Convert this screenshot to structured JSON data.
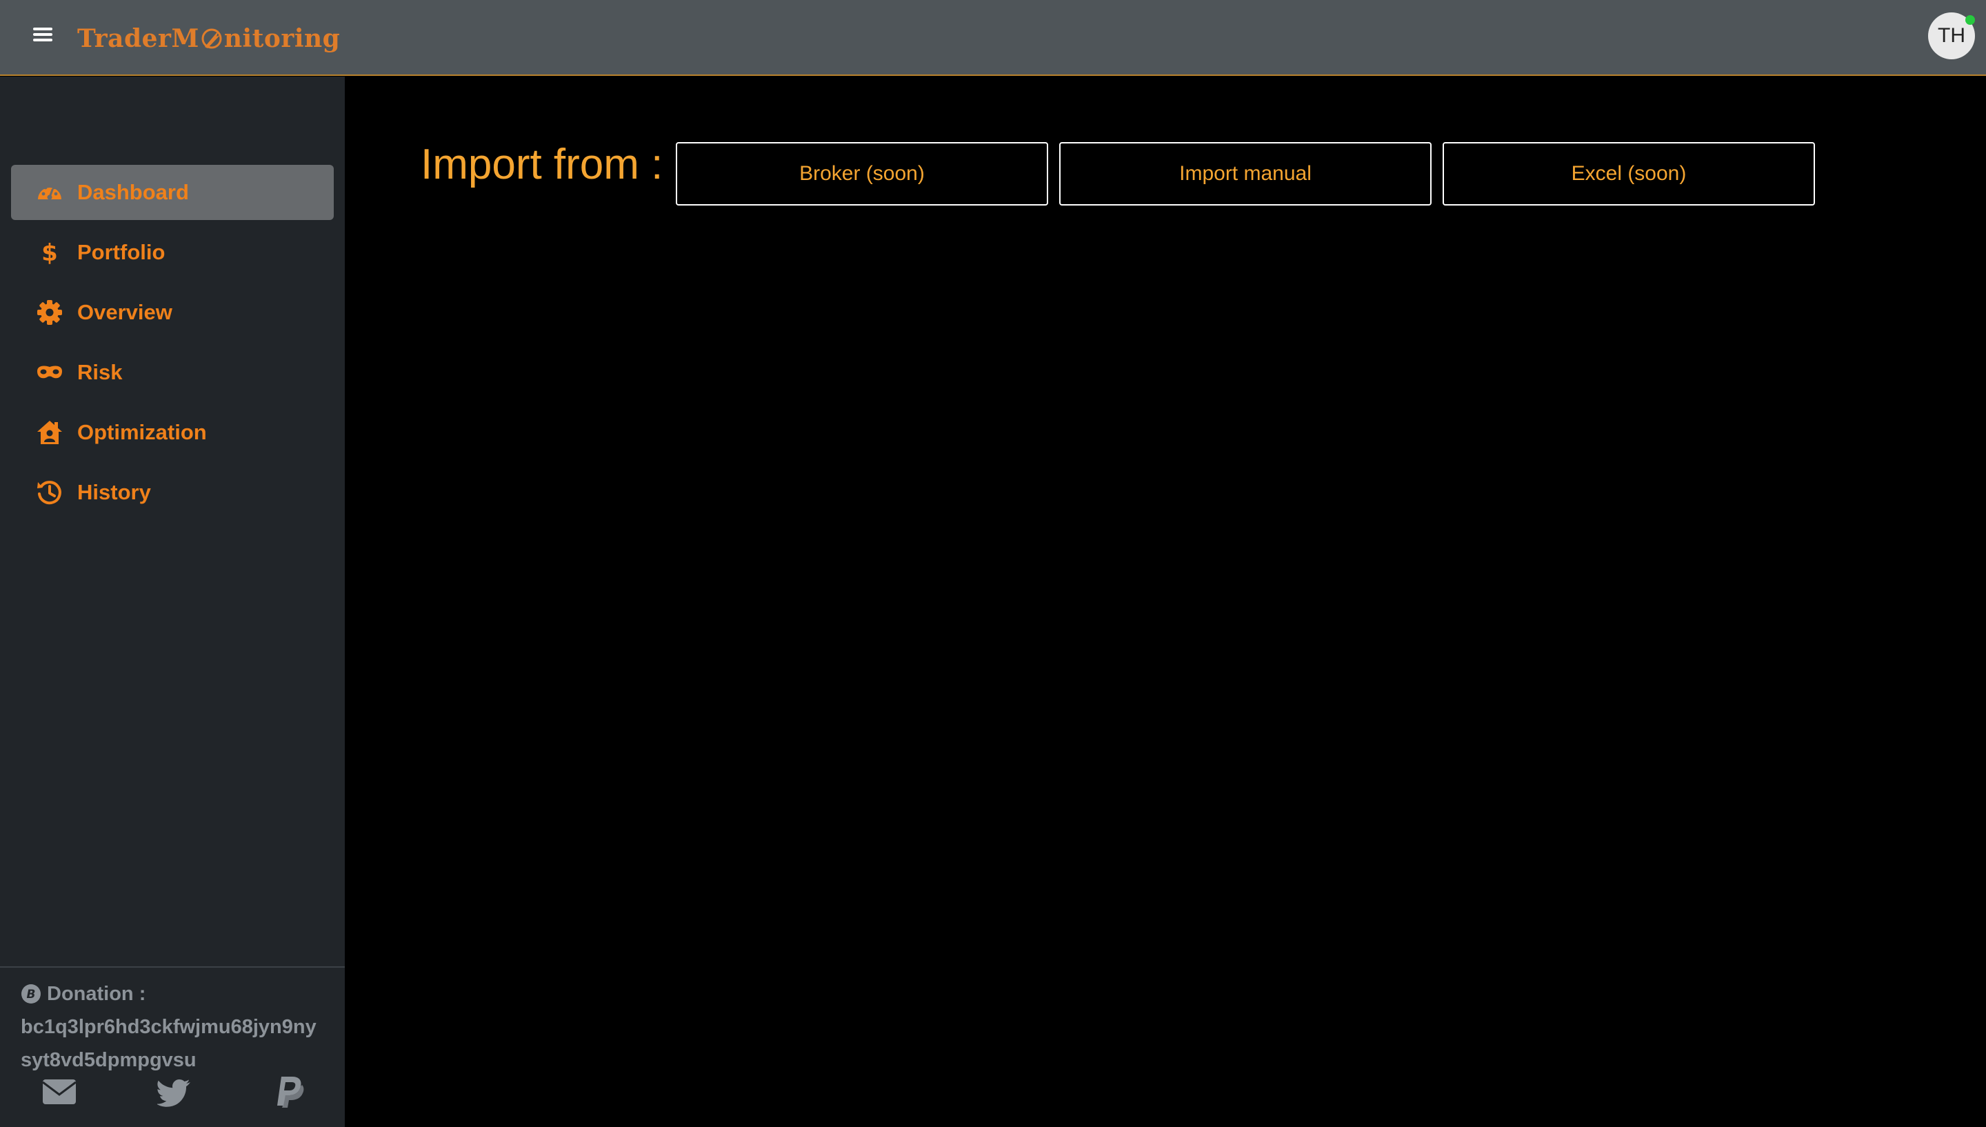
{
  "app": {
    "logo_text_left": "TraderM",
    "logo_text_right": "nitoring",
    "avatar_initials": "TH"
  },
  "sidebar": {
    "items": [
      {
        "label": "Dashboard",
        "icon": "tachometer-icon",
        "active": true
      },
      {
        "label": "Portfolio",
        "icon": "dollar-icon"
      },
      {
        "label": "Overview",
        "icon": "gear-icon"
      },
      {
        "label": "Risk",
        "icon": "mask-icon"
      },
      {
        "label": "Optimization",
        "icon": "house-user-icon"
      },
      {
        "label": "History",
        "icon": "history-icon"
      }
    ],
    "donation_label": "Donation :",
    "donation_address": "bc1q3lpr6hd3ckfwjmu68jyn9nysyt8vd5dpmpgvsu",
    "social": [
      "envelope-icon",
      "twitter-icon",
      "paypal-icon"
    ]
  },
  "main": {
    "import_title": "Import from :",
    "buttons": [
      {
        "label": "Broker (soon)"
      },
      {
        "label": "Import manual"
      },
      {
        "label": "Excel (soon)"
      }
    ]
  },
  "colors": {
    "accent": "#f0811a",
    "title": "#f5a531",
    "topbar": "#4f5559",
    "sidebar": "#212529",
    "active_item": "#676a6d",
    "online": "#27c93f"
  }
}
